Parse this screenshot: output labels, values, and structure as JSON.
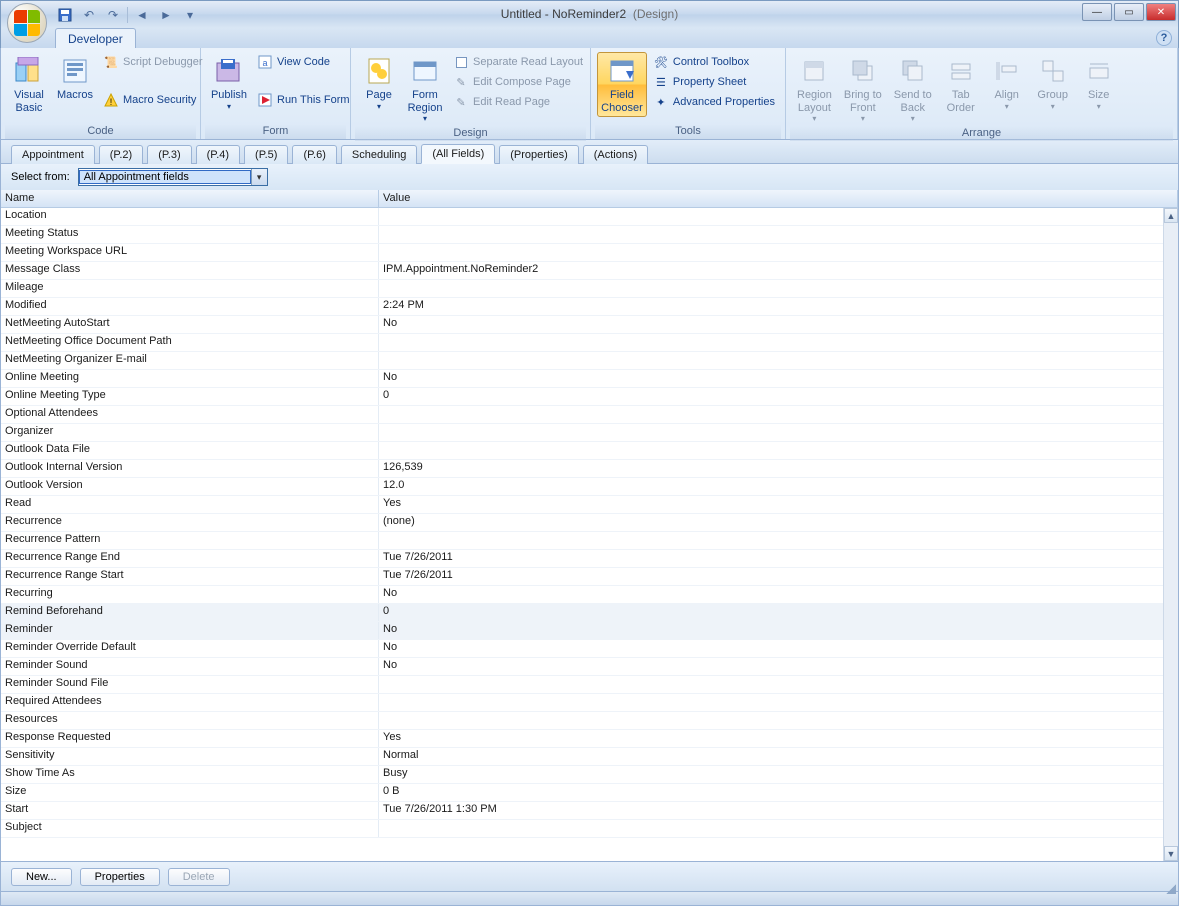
{
  "window": {
    "title_left": "Untitled - NoReminder2",
    "title_right": "(Design)"
  },
  "ribbon": {
    "tab": "Developer",
    "groups": {
      "code": {
        "label": "Code",
        "visual_basic": "Visual\nBasic",
        "macros": "Macros",
        "script_debugger": "Script Debugger",
        "macro_security": "Macro Security"
      },
      "form": {
        "label": "Form",
        "publish": "Publish",
        "view_code": "View Code",
        "run_this_form": "Run This Form"
      },
      "design": {
        "label": "Design",
        "page": "Page",
        "form_region": "Form\nRegion",
        "separate_read_layout": "Separate Read Layout",
        "edit_compose_page": "Edit Compose Page",
        "edit_read_page": "Edit Read Page"
      },
      "tools": {
        "label": "Tools",
        "field_chooser": "Field\nChooser",
        "control_toolbox": "Control Toolbox",
        "property_sheet": "Property Sheet",
        "advanced_properties": "Advanced Properties"
      },
      "arrange": {
        "label": "Arrange",
        "region_layout": "Region\nLayout",
        "bring_to_front": "Bring to\nFront",
        "send_to_back": "Send to\nBack",
        "tab_order": "Tab\nOrder",
        "align": "Align",
        "group": "Group",
        "size": "Size"
      }
    }
  },
  "subtabs": [
    "Appointment",
    "(P.2)",
    "(P.3)",
    "(P.4)",
    "(P.5)",
    "(P.6)",
    "Scheduling",
    "(All Fields)",
    "(Properties)",
    "(Actions)"
  ],
  "subtab_active_index": 7,
  "select_from": {
    "label": "Select from:",
    "value": "All Appointment fields"
  },
  "table": {
    "columns": {
      "name": "Name",
      "value": "Value"
    },
    "rows": [
      {
        "name": "Location",
        "value": ""
      },
      {
        "name": "Meeting Status",
        "value": ""
      },
      {
        "name": "Meeting Workspace URL",
        "value": ""
      },
      {
        "name": "Message Class",
        "value": "IPM.Appointment.NoReminder2"
      },
      {
        "name": "Mileage",
        "value": ""
      },
      {
        "name": "Modified",
        "value": "2:24 PM"
      },
      {
        "name": "NetMeeting AutoStart",
        "value": "No"
      },
      {
        "name": "NetMeeting Office Document Path",
        "value": ""
      },
      {
        "name": "NetMeeting Organizer E-mail",
        "value": ""
      },
      {
        "name": "Online Meeting",
        "value": "No"
      },
      {
        "name": "Online Meeting Type",
        "value": "0"
      },
      {
        "name": "Optional Attendees",
        "value": ""
      },
      {
        "name": "Organizer",
        "value": ""
      },
      {
        "name": "Outlook Data File",
        "value": ""
      },
      {
        "name": "Outlook Internal Version",
        "value": "126,539"
      },
      {
        "name": "Outlook Version",
        "value": "12.0"
      },
      {
        "name": "Read",
        "value": "Yes"
      },
      {
        "name": "Recurrence",
        "value": "(none)"
      },
      {
        "name": "Recurrence Pattern",
        "value": ""
      },
      {
        "name": "Recurrence Range End",
        "value": "Tue 7/26/2011"
      },
      {
        "name": "Recurrence Range Start",
        "value": "Tue 7/26/2011"
      },
      {
        "name": "Recurring",
        "value": "No"
      },
      {
        "name": "Remind Beforehand",
        "value": "0",
        "selected": true
      },
      {
        "name": "Reminder",
        "value": "No",
        "selected": true
      },
      {
        "name": "Reminder Override Default",
        "value": "No"
      },
      {
        "name": "Reminder Sound",
        "value": "No"
      },
      {
        "name": "Reminder Sound File",
        "value": ""
      },
      {
        "name": "Required Attendees",
        "value": ""
      },
      {
        "name": "Resources",
        "value": ""
      },
      {
        "name": "Response Requested",
        "value": "Yes"
      },
      {
        "name": "Sensitivity",
        "value": "Normal"
      },
      {
        "name": "Show Time As",
        "value": "Busy"
      },
      {
        "name": "Size",
        "value": "0 B"
      },
      {
        "name": "Start",
        "value": "Tue 7/26/2011 1:30 PM"
      },
      {
        "name": "Subject",
        "value": ""
      }
    ]
  },
  "footer": {
    "new": "New...",
    "properties": "Properties",
    "delete": "Delete"
  }
}
